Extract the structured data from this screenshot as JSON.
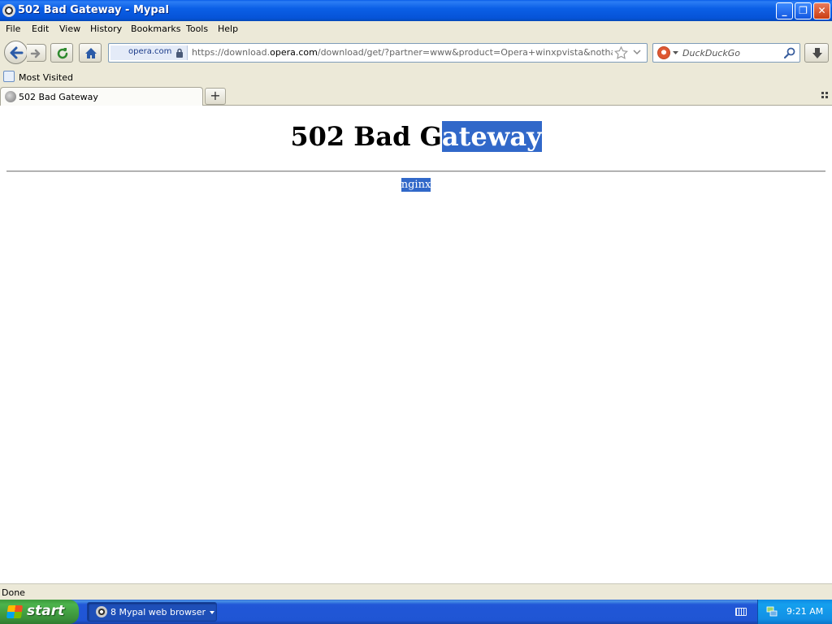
{
  "window": {
    "title": "502 Bad Gateway - Mypal",
    "minimize_glyph": "_",
    "maximize_glyph": "❐",
    "close_glyph": "✕"
  },
  "menu": {
    "items": [
      "File",
      "Edit",
      "View",
      "History",
      "Bookmarks",
      "Tools",
      "Help"
    ]
  },
  "navigation": {
    "identity_label": "opera.com",
    "url_prefix": "https://download.",
    "url_domain": "opera.com",
    "url_rest": "/download/get/?partner=www&product=Opera+winxpvista&nothanks=yes&s",
    "search_placeholder": "DuckDuckGo"
  },
  "bookmarks": {
    "items": [
      {
        "label": "Most Visited",
        "icon": "bookmark-folder-icon"
      }
    ]
  },
  "tabs": {
    "items": [
      {
        "label": "502 Bad Gateway",
        "active": true
      }
    ],
    "new_tab_glyph": "+"
  },
  "page": {
    "heading_plain": "502 Bad G",
    "heading_selected": "ateway",
    "server_name": "nginx",
    "selection_color": "#3168c9"
  },
  "status": {
    "text": "Done"
  },
  "taskbar": {
    "start_label": "start",
    "task_label": "8 Mypal web browser",
    "clock": "9:21 AM"
  }
}
